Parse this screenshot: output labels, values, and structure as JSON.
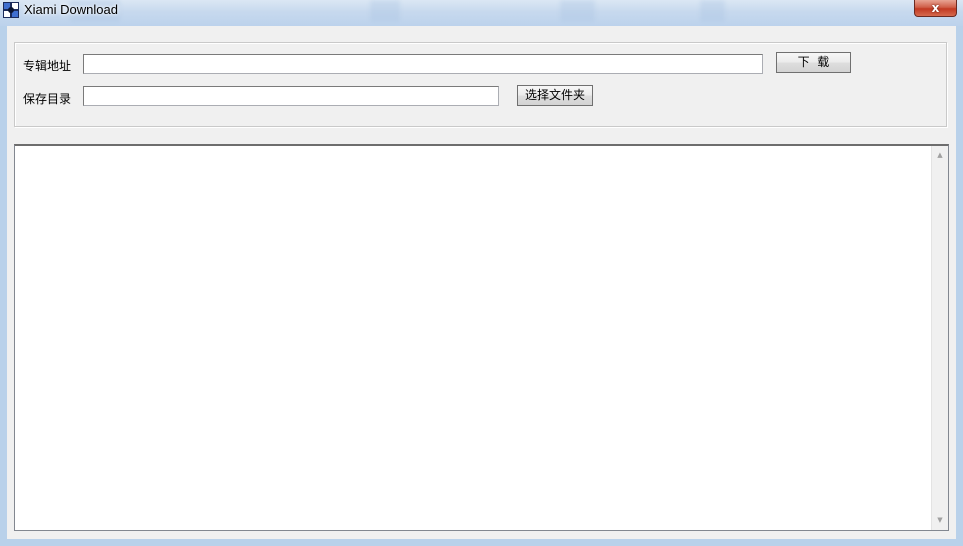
{
  "window": {
    "title": "Xiami Download",
    "close_glyph": "x"
  },
  "album_url": {
    "label": "专辑地址",
    "value": ""
  },
  "download_button": {
    "label": "下  载"
  },
  "save_dir": {
    "label": "保存目录",
    "value": ""
  },
  "choose_folder_button": {
    "label": "选择文件夹"
  },
  "log": {
    "content": ""
  },
  "icons": {
    "app": "app-icon",
    "close": "close-icon",
    "scroll_up": "scroll-up-arrow-icon",
    "scroll_down": "scroll-down-arrow-icon"
  },
  "colors": {
    "close_button": "#c23a23",
    "client_bg": "#f0f0f0",
    "frame": "#b9d1ea"
  }
}
